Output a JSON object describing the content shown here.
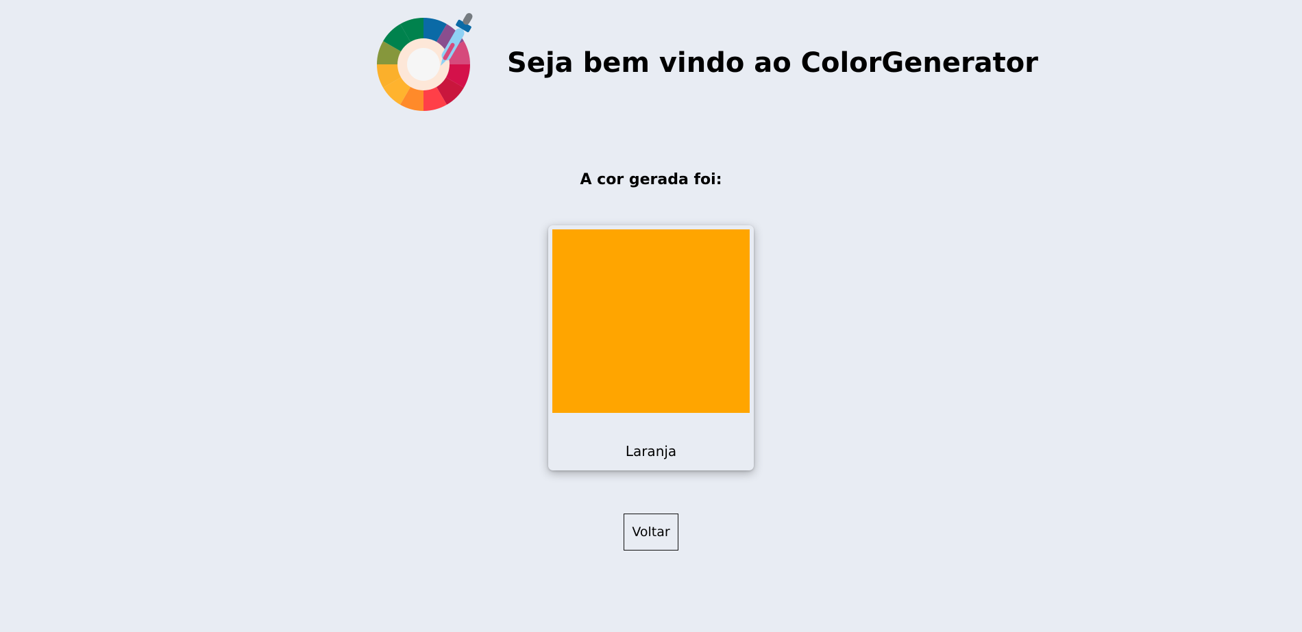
{
  "header": {
    "logo_icon": "color-wheel-dropper-icon",
    "title": "Seja bem vindo ao ColorGenerator"
  },
  "result": {
    "heading": "A cor gerada foi:",
    "color_name": "Laranja",
    "color_hex": "#FFA500"
  },
  "actions": {
    "back_label": "Voltar"
  },
  "colors": {
    "background": "#e8ecf3"
  }
}
